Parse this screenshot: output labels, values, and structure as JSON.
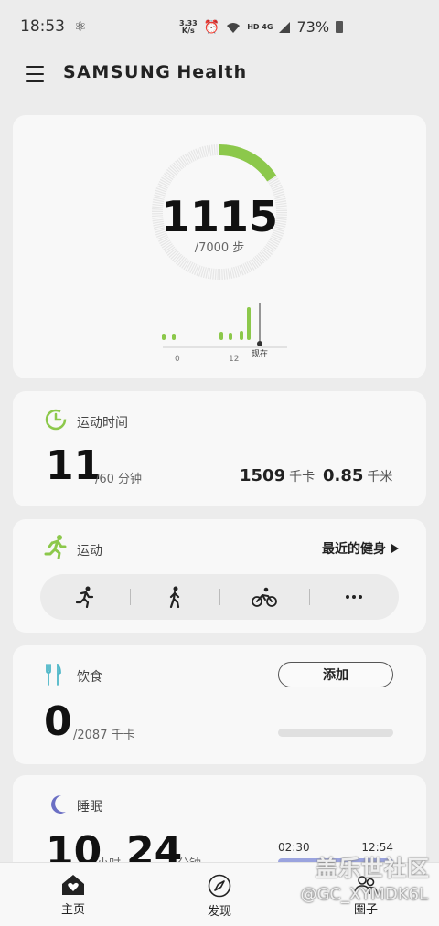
{
  "status": {
    "time": "18:53",
    "speed_top": "3.33",
    "speed_bottom": "K/s",
    "network": "HD 4G",
    "battery": "73%"
  },
  "app": {
    "brand_part1": "SAMSUNG",
    "brand_part2": "Health"
  },
  "steps": {
    "count": "1115",
    "goal": "/7000 步",
    "axis_labels": [
      "0",
      "12",
      "现在"
    ],
    "progress": 0.159
  },
  "active_time": {
    "title": "运动时间",
    "value": "11",
    "unit": "/60 分钟",
    "calories_value": "1509",
    "calories_unit": "千卡",
    "distance_value": "0.85",
    "distance_unit": "千米"
  },
  "exercise": {
    "title": "运动",
    "recent_label": "最近的健身"
  },
  "food": {
    "title": "饮食",
    "value": "0",
    "unit": "/2087 千卡",
    "add_label": "添加"
  },
  "sleep": {
    "title": "睡眠",
    "hours": "10",
    "hours_unit": "小时",
    "minutes": "24",
    "minutes_unit": "分钟",
    "start": "02:30",
    "end": "12:54"
  },
  "nav": {
    "home": "主页",
    "discover": "发现",
    "together": "圈子"
  },
  "watermark": {
    "line1": "盖乐世社区",
    "line2": "@GC_XYMDK6L"
  },
  "colors": {
    "accent_green": "#8cc84b",
    "sleep_bar": "#9aa3de",
    "moon": "#6b6fc4"
  }
}
